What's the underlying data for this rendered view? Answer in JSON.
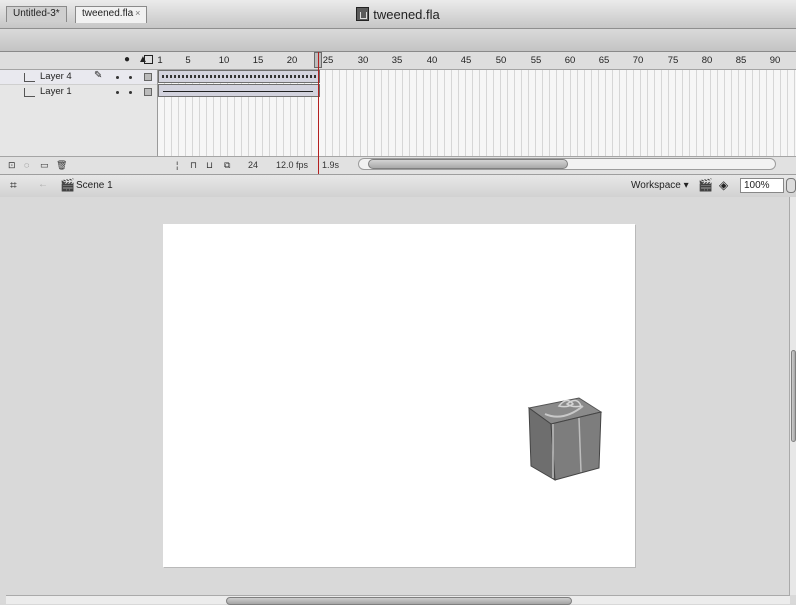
{
  "window": {
    "title": "tweened.fla"
  },
  "tabs": [
    {
      "label": "Untitled-3*"
    },
    {
      "label": "tweened.fla",
      "close": "×"
    }
  ],
  "timeline": {
    "frame_numbers": [
      "1",
      "5",
      "10",
      "15",
      "20",
      "25",
      "30",
      "35",
      "40",
      "45",
      "50",
      "55",
      "60",
      "65",
      "70",
      "75",
      "80",
      "85",
      "90"
    ],
    "layers": [
      {
        "name": "Layer 4"
      },
      {
        "name": "Layer 1"
      }
    ],
    "current_frame": "24",
    "fps": "12.0 fps",
    "elapsed": "1.9s"
  },
  "editbar": {
    "scene_label": "Scene 1",
    "workspace_label": "Workspace ▾",
    "zoom_value": "100%"
  },
  "icons": {
    "traffic": "window-control-icon",
    "file": "fla-document-icon",
    "scene": "clapper-icon",
    "pencil": "pencil-icon"
  },
  "colors": {
    "stage": "#ffffff",
    "pasteboard": "#d9d9d9"
  }
}
